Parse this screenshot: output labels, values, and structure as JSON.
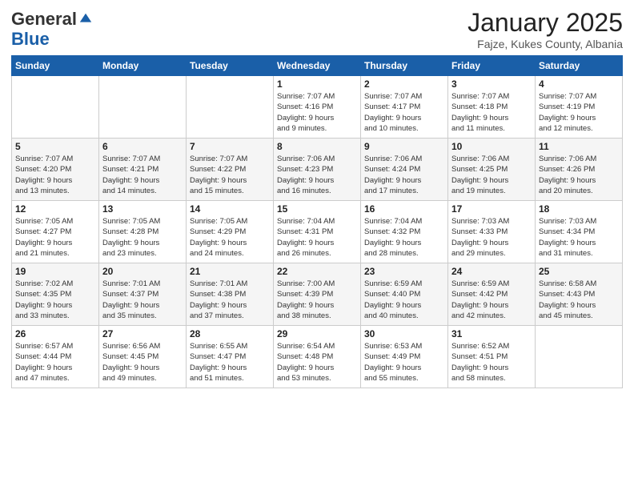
{
  "header": {
    "logo_general": "General",
    "logo_blue": "Blue",
    "month_title": "January 2025",
    "location": "Fajze, Kukes County, Albania"
  },
  "days_of_week": [
    "Sunday",
    "Monday",
    "Tuesday",
    "Wednesday",
    "Thursday",
    "Friday",
    "Saturday"
  ],
  "weeks": [
    [
      {
        "day": "",
        "info": ""
      },
      {
        "day": "",
        "info": ""
      },
      {
        "day": "",
        "info": ""
      },
      {
        "day": "1",
        "info": "Sunrise: 7:07 AM\nSunset: 4:16 PM\nDaylight: 9 hours\nand 9 minutes."
      },
      {
        "day": "2",
        "info": "Sunrise: 7:07 AM\nSunset: 4:17 PM\nDaylight: 9 hours\nand 10 minutes."
      },
      {
        "day": "3",
        "info": "Sunrise: 7:07 AM\nSunset: 4:18 PM\nDaylight: 9 hours\nand 11 minutes."
      },
      {
        "day": "4",
        "info": "Sunrise: 7:07 AM\nSunset: 4:19 PM\nDaylight: 9 hours\nand 12 minutes."
      }
    ],
    [
      {
        "day": "5",
        "info": "Sunrise: 7:07 AM\nSunset: 4:20 PM\nDaylight: 9 hours\nand 13 minutes."
      },
      {
        "day": "6",
        "info": "Sunrise: 7:07 AM\nSunset: 4:21 PM\nDaylight: 9 hours\nand 14 minutes."
      },
      {
        "day": "7",
        "info": "Sunrise: 7:07 AM\nSunset: 4:22 PM\nDaylight: 9 hours\nand 15 minutes."
      },
      {
        "day": "8",
        "info": "Sunrise: 7:06 AM\nSunset: 4:23 PM\nDaylight: 9 hours\nand 16 minutes."
      },
      {
        "day": "9",
        "info": "Sunrise: 7:06 AM\nSunset: 4:24 PM\nDaylight: 9 hours\nand 17 minutes."
      },
      {
        "day": "10",
        "info": "Sunrise: 7:06 AM\nSunset: 4:25 PM\nDaylight: 9 hours\nand 19 minutes."
      },
      {
        "day": "11",
        "info": "Sunrise: 7:06 AM\nSunset: 4:26 PM\nDaylight: 9 hours\nand 20 minutes."
      }
    ],
    [
      {
        "day": "12",
        "info": "Sunrise: 7:05 AM\nSunset: 4:27 PM\nDaylight: 9 hours\nand 21 minutes."
      },
      {
        "day": "13",
        "info": "Sunrise: 7:05 AM\nSunset: 4:28 PM\nDaylight: 9 hours\nand 23 minutes."
      },
      {
        "day": "14",
        "info": "Sunrise: 7:05 AM\nSunset: 4:29 PM\nDaylight: 9 hours\nand 24 minutes."
      },
      {
        "day": "15",
        "info": "Sunrise: 7:04 AM\nSunset: 4:31 PM\nDaylight: 9 hours\nand 26 minutes."
      },
      {
        "day": "16",
        "info": "Sunrise: 7:04 AM\nSunset: 4:32 PM\nDaylight: 9 hours\nand 28 minutes."
      },
      {
        "day": "17",
        "info": "Sunrise: 7:03 AM\nSunset: 4:33 PM\nDaylight: 9 hours\nand 29 minutes."
      },
      {
        "day": "18",
        "info": "Sunrise: 7:03 AM\nSunset: 4:34 PM\nDaylight: 9 hours\nand 31 minutes."
      }
    ],
    [
      {
        "day": "19",
        "info": "Sunrise: 7:02 AM\nSunset: 4:35 PM\nDaylight: 9 hours\nand 33 minutes."
      },
      {
        "day": "20",
        "info": "Sunrise: 7:01 AM\nSunset: 4:37 PM\nDaylight: 9 hours\nand 35 minutes."
      },
      {
        "day": "21",
        "info": "Sunrise: 7:01 AM\nSunset: 4:38 PM\nDaylight: 9 hours\nand 37 minutes."
      },
      {
        "day": "22",
        "info": "Sunrise: 7:00 AM\nSunset: 4:39 PM\nDaylight: 9 hours\nand 38 minutes."
      },
      {
        "day": "23",
        "info": "Sunrise: 6:59 AM\nSunset: 4:40 PM\nDaylight: 9 hours\nand 40 minutes."
      },
      {
        "day": "24",
        "info": "Sunrise: 6:59 AM\nSunset: 4:42 PM\nDaylight: 9 hours\nand 42 minutes."
      },
      {
        "day": "25",
        "info": "Sunrise: 6:58 AM\nSunset: 4:43 PM\nDaylight: 9 hours\nand 45 minutes."
      }
    ],
    [
      {
        "day": "26",
        "info": "Sunrise: 6:57 AM\nSunset: 4:44 PM\nDaylight: 9 hours\nand 47 minutes."
      },
      {
        "day": "27",
        "info": "Sunrise: 6:56 AM\nSunset: 4:45 PM\nDaylight: 9 hours\nand 49 minutes."
      },
      {
        "day": "28",
        "info": "Sunrise: 6:55 AM\nSunset: 4:47 PM\nDaylight: 9 hours\nand 51 minutes."
      },
      {
        "day": "29",
        "info": "Sunrise: 6:54 AM\nSunset: 4:48 PM\nDaylight: 9 hours\nand 53 minutes."
      },
      {
        "day": "30",
        "info": "Sunrise: 6:53 AM\nSunset: 4:49 PM\nDaylight: 9 hours\nand 55 minutes."
      },
      {
        "day": "31",
        "info": "Sunrise: 6:52 AM\nSunset: 4:51 PM\nDaylight: 9 hours\nand 58 minutes."
      },
      {
        "day": "",
        "info": ""
      }
    ]
  ]
}
